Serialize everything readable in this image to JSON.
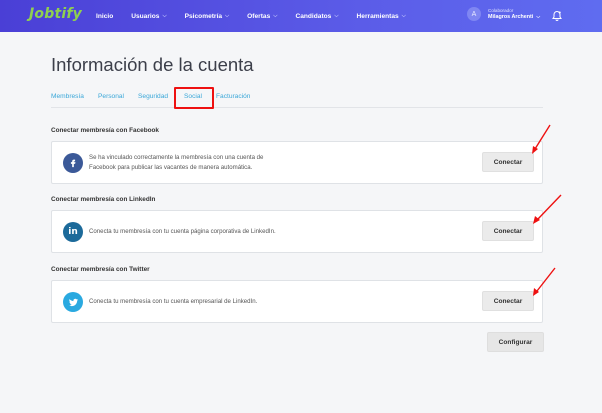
{
  "header": {
    "logo": "Jobtify",
    "nav": [
      {
        "label": "Inicio",
        "dropdown": false
      },
      {
        "label": "Usuarios",
        "dropdown": true
      },
      {
        "label": "Psicometría",
        "dropdown": true
      },
      {
        "label": "Ofertas",
        "dropdown": true
      },
      {
        "label": "Candidatos",
        "dropdown": true
      },
      {
        "label": "Herramientas",
        "dropdown": true
      }
    ],
    "user": {
      "avatar_initial": "A",
      "role": "Colaborador",
      "name": "Milagros Archenti"
    },
    "bell_icon": "bell-icon",
    "gradient_colors": [
      "#4a3fd6",
      "#5f6cf0"
    ]
  },
  "page": {
    "title": "Información de la cuenta"
  },
  "tabs": [
    {
      "label": "Membresía"
    },
    {
      "label": "Personal"
    },
    {
      "label": "Seguridad"
    },
    {
      "label": "Social",
      "active": true
    },
    {
      "label": "Facturación"
    }
  ],
  "sections": [
    {
      "title": "Conectar membresía con Facebook",
      "icon": "facebook-icon",
      "icon_color": "#3b5998",
      "text_lines": [
        "Se ha vinculado correctamente la membresía con una cuenta de",
        "Facebook para publicar las vacantes de manera automática."
      ],
      "button": "Conectar"
    },
    {
      "title": "Conectar membresía con LinkedIn",
      "icon": "linkedin-icon",
      "icon_color": "#1c6a9a",
      "text_lines": [
        "Conecta tu membresía con tu cuenta página corporativa de LinkedIn."
      ],
      "button": "Conectar"
    },
    {
      "title": "Conectar membresía con Twitter",
      "icon": "twitter-icon",
      "icon_color": "#2aa9e0",
      "text_lines": [
        "Conecta tu membresía con tu cuenta empresarial de LinkedIn."
      ],
      "button": "Conectar"
    }
  ],
  "footer": {
    "configure_button": "Configurar"
  },
  "annotation_color": "#e11111"
}
